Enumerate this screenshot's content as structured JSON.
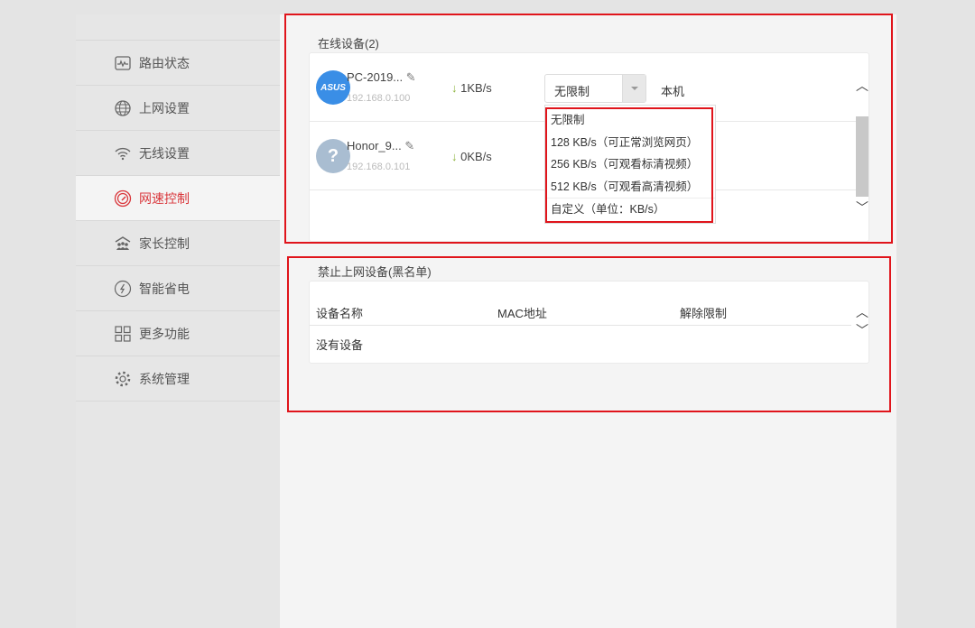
{
  "sidebar": {
    "items": [
      {
        "label": "路由状态",
        "icon": "monitor-icon"
      },
      {
        "label": "上网设置",
        "icon": "globe-icon"
      },
      {
        "label": "无线设置",
        "icon": "wifi-icon"
      },
      {
        "label": "网速控制",
        "icon": "speedometer-icon",
        "active": true
      },
      {
        "label": "家长控制",
        "icon": "family-icon"
      },
      {
        "label": "智能省电",
        "icon": "power-save-icon"
      },
      {
        "label": "更多功能",
        "icon": "grid-icon"
      },
      {
        "label": "系统管理",
        "icon": "gear-icon"
      }
    ]
  },
  "online": {
    "title": "在线设备(2)",
    "devices": [
      {
        "name": "PC-2019...",
        "ip": "192.168.0.100",
        "speed": "1KB/s",
        "arrow": "↓",
        "limit": "无限制",
        "note": "本机",
        "avatar": "ASUS",
        "avatar_color": "#3a8ee6"
      },
      {
        "name": "Honor_9...",
        "ip": "192.168.0.101",
        "speed": "0KB/s",
        "arrow": "↓",
        "avatar": "?",
        "avatar_color": "#a9bdd1"
      }
    ],
    "dropdown_options": [
      "无限制",
      "128 KB/s（可正常浏览网页）",
      "256 KB/s（可观看标清视频）",
      "512 KB/s（可观看高清视频）",
      "自定义（单位：KB/s）"
    ]
  },
  "blacklist": {
    "title": "禁止上网设备(黑名单)",
    "columns": [
      "设备名称",
      "MAC地址",
      "解除限制"
    ],
    "empty": "没有设备"
  },
  "colors": {
    "accent": "#d9353a",
    "annotation": "#e0141b"
  }
}
